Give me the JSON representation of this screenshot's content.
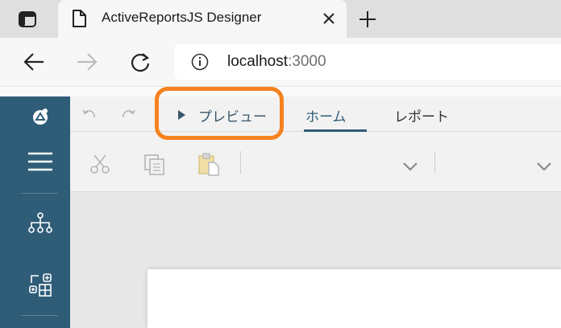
{
  "browser": {
    "tab_title": "ActiveReportsJS Designer",
    "url_host": "localhost",
    "url_port": ":3000"
  },
  "designer": {
    "menu": {
      "preview_label": "プレビュー",
      "home_label": "ホーム",
      "report_label": "レポート"
    }
  },
  "colors": {
    "sidebar": "#2f5d78",
    "highlight": "#f5821f",
    "active_tab": "#2f5d78"
  },
  "icons": [
    "tab-actions-icon",
    "page-icon",
    "close-icon",
    "plus-icon",
    "back-icon",
    "forward-icon",
    "refresh-icon",
    "info-icon",
    "logo-icon",
    "hamburger-icon",
    "tree-icon",
    "components-icon",
    "undo-icon",
    "redo-icon",
    "play-icon",
    "cut-icon",
    "copy-icon",
    "paste-icon",
    "chevron-down-icon"
  ]
}
